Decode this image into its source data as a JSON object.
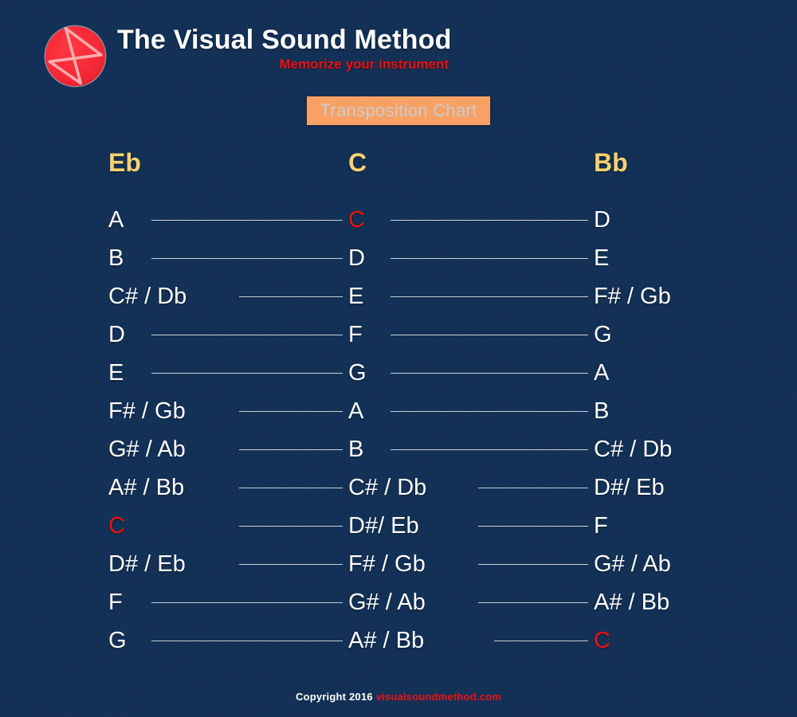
{
  "theme": {
    "background": "#123056",
    "accent_red": "#ee1111",
    "banner_bg": "#f9a164",
    "banner_text": "#c9ccce",
    "header_gold": "#f7d172",
    "note_white": "#ffffff",
    "line_color": "#d8dde2",
    "logo_red": "#f32735"
  },
  "brand": {
    "logo_icon": "visual-sound-method-logo",
    "title": "The Visual Sound Method",
    "tagline": "Memorize your instrument"
  },
  "banner": {
    "label": "Transposition Chart"
  },
  "chart_data": {
    "type": "table",
    "title": "Transposition Chart",
    "columns": [
      "Eb",
      "C",
      "Bb"
    ],
    "rows": [
      {
        "cells": [
          "A",
          "C",
          "D"
        ],
        "accent": [
          false,
          true,
          false
        ],
        "lines": [
          {
            "start": 190,
            "end": 430
          },
          {
            "start": 490,
            "end": 738
          }
        ]
      },
      {
        "cells": [
          "B",
          "D",
          "E"
        ],
        "accent": [
          false,
          false,
          false
        ],
        "lines": [
          {
            "start": 190,
            "end": 430
          },
          {
            "start": 490,
            "end": 738
          }
        ]
      },
      {
        "cells": [
          "C# / Db",
          "E",
          "F# / Gb"
        ],
        "accent": [
          false,
          false,
          false
        ],
        "lines": [
          {
            "start": 300,
            "end": 430
          },
          {
            "start": 490,
            "end": 738
          }
        ]
      },
      {
        "cells": [
          "D",
          "F",
          "G"
        ],
        "accent": [
          false,
          false,
          false
        ],
        "lines": [
          {
            "start": 190,
            "end": 430
          },
          {
            "start": 490,
            "end": 738
          }
        ]
      },
      {
        "cells": [
          "E",
          "G",
          "A"
        ],
        "accent": [
          false,
          false,
          false
        ],
        "lines": [
          {
            "start": 190,
            "end": 430
          },
          {
            "start": 490,
            "end": 738
          }
        ]
      },
      {
        "cells": [
          "F#  / Gb",
          "A",
          "B"
        ],
        "accent": [
          false,
          false,
          false
        ],
        "lines": [
          {
            "start": 300,
            "end": 430
          },
          {
            "start": 490,
            "end": 738
          }
        ]
      },
      {
        "cells": [
          "G# / Ab",
          "B",
          "C# / Db"
        ],
        "accent": [
          false,
          false,
          false
        ],
        "lines": [
          {
            "start": 300,
            "end": 430
          },
          {
            "start": 490,
            "end": 738
          }
        ]
      },
      {
        "cells": [
          "A# / Bb",
          "C# / Db",
          "D#/ Eb"
        ],
        "accent": [
          false,
          false,
          false
        ],
        "lines": [
          {
            "start": 300,
            "end": 430
          },
          {
            "start": 600,
            "end": 738
          }
        ]
      },
      {
        "cells": [
          "C",
          "D#/ Eb",
          "F"
        ],
        "accent": [
          true,
          false,
          false
        ],
        "lines": [
          {
            "start": 300,
            "end": 430
          },
          {
            "start": 600,
            "end": 738
          }
        ]
      },
      {
        "cells": [
          "D# / Eb",
          "F# / Gb",
          "G# / Ab"
        ],
        "accent": [
          false,
          false,
          false
        ],
        "lines": [
          {
            "start": 300,
            "end": 430
          },
          {
            "start": 600,
            "end": 738
          }
        ]
      },
      {
        "cells": [
          "F",
          "G# / Ab",
          "A# / Bb"
        ],
        "accent": [
          false,
          false,
          false
        ],
        "lines": [
          {
            "start": 190,
            "end": 430
          },
          {
            "start": 600,
            "end": 738
          }
        ]
      },
      {
        "cells": [
          "G",
          "A# / Bb",
          "C"
        ],
        "accent": [
          false,
          false,
          true
        ],
        "lines": [
          {
            "start": 190,
            "end": 430
          },
          {
            "start": 620,
            "end": 738
          }
        ]
      }
    ]
  },
  "footer": {
    "copyright": "Copyright 2016",
    "site": "visualsoundmethod.com"
  }
}
